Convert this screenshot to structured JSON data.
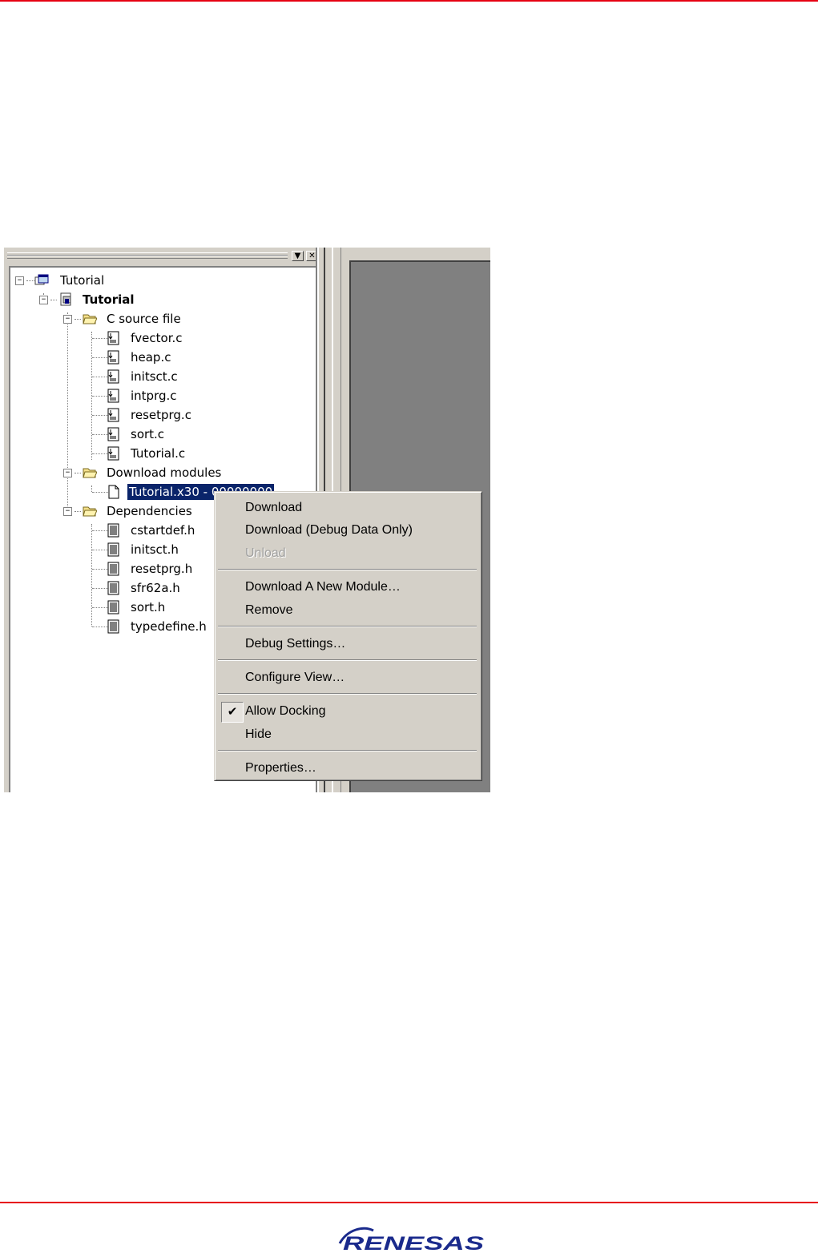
{
  "brand": {
    "logo_text": "RENESAS",
    "accent": "#e60012"
  },
  "window": {
    "pane_buttons": [
      "▼",
      "✕"
    ]
  },
  "tree": {
    "workspace": "Tutorial",
    "project": "Tutorial",
    "folders": [
      {
        "label": "C source file",
        "items": [
          "fvector.c",
          "heap.c",
          "initsct.c",
          "intprg.c",
          "resetprg.c",
          "sort.c",
          "Tutorial.c"
        ]
      },
      {
        "label": "Download modules",
        "items": [
          "Tutorial.x30 - 00000000"
        ]
      },
      {
        "label": "Dependencies",
        "items": [
          "cstartdef.h",
          "initsct.h",
          "resetprg.h",
          "sfr62a.h",
          "sort.h",
          "typedefine.h"
        ]
      }
    ],
    "expander_symbol": "−",
    "selected_color": "#0a246a"
  },
  "context_menu": {
    "items": [
      {
        "label": "Download",
        "enabled": true
      },
      {
        "label": "Download (Debug Data Only)",
        "enabled": true
      },
      {
        "label": "Unload",
        "enabled": false
      },
      {
        "label": "Download A New Module…",
        "enabled": true
      },
      {
        "label": "Remove",
        "enabled": true
      },
      {
        "label": "Debug Settings…",
        "enabled": true
      },
      {
        "label": "Configure View…",
        "enabled": true
      },
      {
        "label": "Allow Docking",
        "enabled": true,
        "checked": true
      },
      {
        "label": "Hide",
        "enabled": true
      },
      {
        "label": "Properties…",
        "enabled": true
      }
    ],
    "check_glyph": "✔"
  }
}
